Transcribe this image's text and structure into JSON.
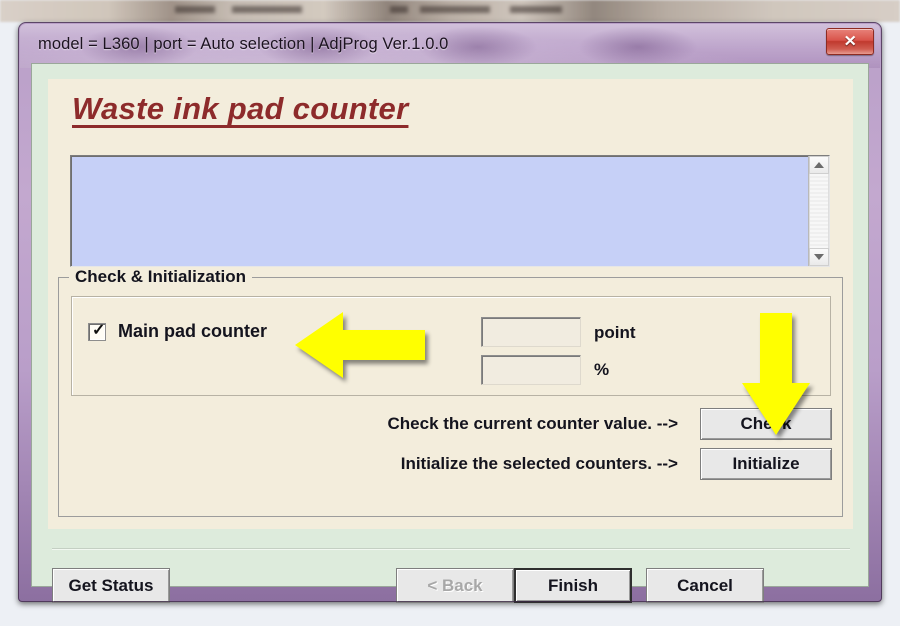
{
  "window": {
    "title": "model = L360 | port = Auto selection | AdjProg Ver.1.0.0",
    "close_glyph": "✕",
    "close_icon_name": "close-icon",
    "accent_titlebar": "#b99fc8",
    "accent_close": "#c0392e"
  },
  "page": {
    "heading": "Waste ink pad counter",
    "heading_color": "#8d2b2b",
    "panel_bg": "#f3eddc",
    "client_bg": "#ddebdc",
    "log": {
      "content": "",
      "bg": "#c6d0f7"
    },
    "scrollbar": {
      "up_icon": "scroll-up-arrow-icon",
      "down_icon": "scroll-down-arrow-icon"
    }
  },
  "group": {
    "legend": "Check & Initialization",
    "checkbox": {
      "label": "Main pad counter",
      "checked": true,
      "mark": "✓"
    },
    "fields": [
      {
        "name": "point-field",
        "value": "",
        "unit": "point"
      },
      {
        "name": "percent-field",
        "value": "",
        "unit": "%"
      }
    ],
    "actions": [
      {
        "label": "Check the current counter value. -->",
        "button": "Check"
      },
      {
        "label": "Initialize the selected counters. -->",
        "button": "Initialize"
      }
    ]
  },
  "footer": {
    "get_status": "Get Status",
    "back": "< Back",
    "back_disabled": true,
    "finish": "Finish",
    "finish_is_default": true,
    "cancel": "Cancel"
  },
  "annotations": {
    "color": "#ffff00",
    "arrows": [
      {
        "name": "pointer-arrow-left",
        "direction": "left",
        "points_at": "Main pad counter"
      },
      {
        "name": "pointer-arrow-down",
        "direction": "down",
        "points_at": "Check"
      }
    ]
  }
}
